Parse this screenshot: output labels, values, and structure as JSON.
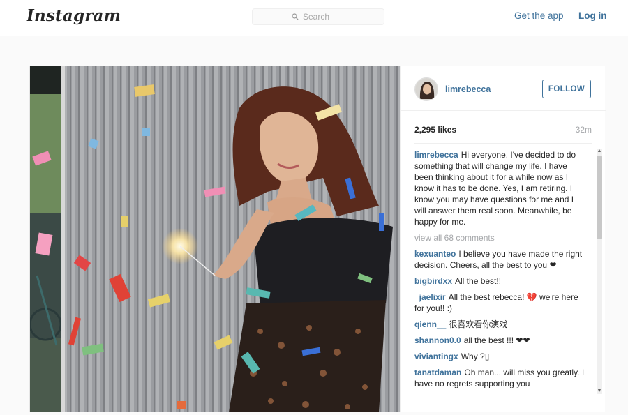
{
  "header": {
    "logo": "Instagram",
    "search_placeholder": "Search",
    "get_app": "Get the app",
    "login": "Log in"
  },
  "post": {
    "username": "limrebecca",
    "follow_label": "FOLLOW",
    "likes": "2,295 likes",
    "time": "32m",
    "caption": {
      "user": "limrebecca",
      "text": "Hi everyone. I've decided to do something that will change my life. I have been thinking about it for a while now as I know it has to be done. Yes, I am retiring. I know you may have questions for me and I will answer them real soon. Meanwhile, be happy for me."
    },
    "view_all": "view all 68 comments",
    "comments": [
      {
        "user": "kexuanteo",
        "text": "I believe you have made the right decision. Cheers, all the best to you ❤"
      },
      {
        "user": "bigbirdxx",
        "text": "All the best!!"
      },
      {
        "user": "_jaelixir",
        "text": "All the best rebecca! 💔 we're here for you!! :)"
      },
      {
        "user": "qienn__",
        "text": "很喜欢看你演戏"
      },
      {
        "user": "shannon0.0",
        "text": "all the best !!! ❤❤"
      },
      {
        "user": "viviantingx",
        "text": "Why ?▯"
      },
      {
        "user": "tanatdaman",
        "text": "Oh man... will miss you greatly. I have no regrets supporting you"
      }
    ]
  },
  "colors": {
    "link": "#3f729b",
    "muted": "#a5a7aa",
    "text": "#262626"
  }
}
